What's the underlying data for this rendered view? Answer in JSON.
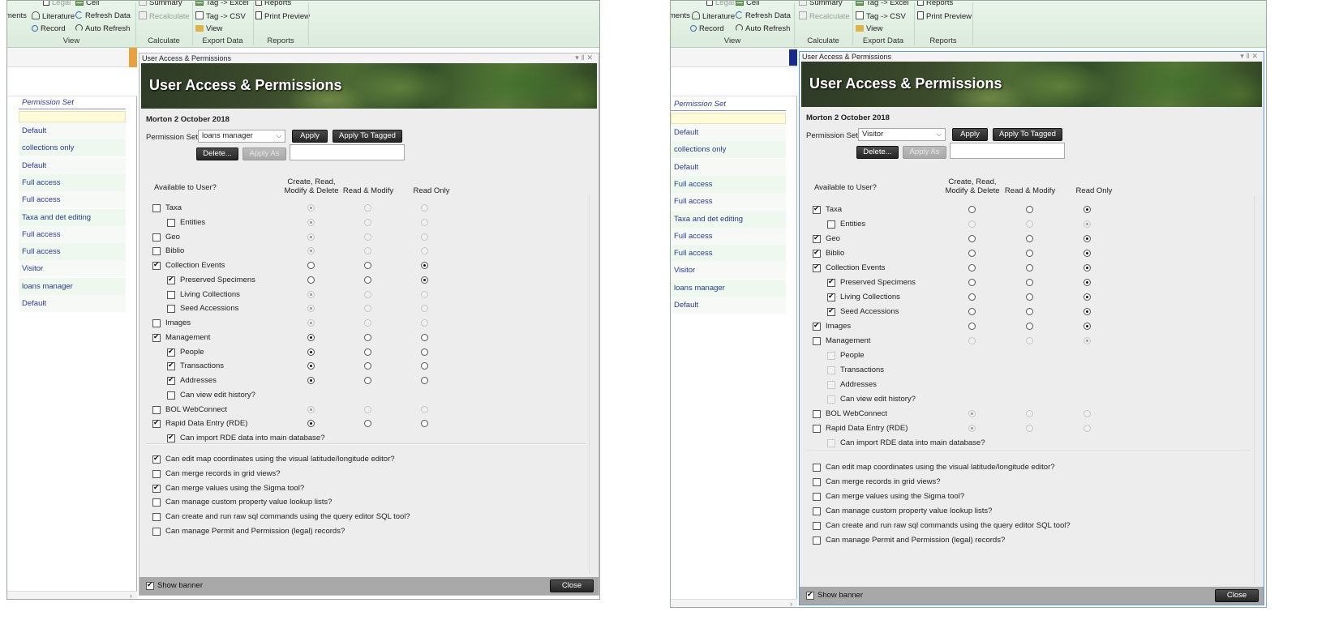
{
  "ribbon": {
    "items": {
      "legal": "Legal",
      "cell": "Cell",
      "summary": "Summary",
      "tag_excel": "Tag -> Excel",
      "reports_btn": "Reports",
      "ments": "ments",
      "literature": "Literature",
      "refresh_data": "Refresh Data",
      "recalculate": "Recalculate",
      "tag_csv": "Tag -> CSV",
      "print_preview": "Print Preview",
      "record": "Record",
      "auto_refresh": "Auto Refresh",
      "view_btn": "View"
    },
    "groups": {
      "view": "View",
      "calculate": "Calculate",
      "export": "Export Data",
      "reports": "Reports"
    }
  },
  "left": {
    "list_header": "Permission Set",
    "rows": [
      "Default",
      "collections only",
      "Default",
      "Full access",
      "Full access",
      "Taxa and det editing",
      "Full access",
      "Full access",
      "Visitor",
      "loans manager",
      "Default"
    ],
    "dialog": {
      "window_title": "User Access & Permissions",
      "banner_title": "User Access & Permissions",
      "subtitle": "Morton 2 October 2018",
      "perm_label": "Permission Set:",
      "perm_value": "loans manager",
      "apply": "Apply",
      "apply_tagged": "Apply To Tagged",
      "delete": "Delete...",
      "apply_as": "Apply As",
      "col_available": "Available to User?",
      "col_crmd_1": "Create, Read,",
      "col_crmd_2": "Modify & Delete",
      "col_rm": "Read & Modify",
      "col_ro": "Read Only",
      "modules": [
        {
          "label": "Taxa"
        },
        {
          "label": "Entities"
        },
        {
          "label": "Geo"
        },
        {
          "label": "Biblio"
        },
        {
          "label": "Collection Events"
        },
        {
          "label": "Preserved Specimens"
        },
        {
          "label": "Living Collections"
        },
        {
          "label": "Seed Accessions"
        },
        {
          "label": "Images"
        },
        {
          "label": "Management"
        },
        {
          "label": "People"
        },
        {
          "label": "Transactions"
        },
        {
          "label": "Addresses"
        },
        {
          "label": "Can view edit history?"
        },
        {
          "label": "BOL WebConnect"
        },
        {
          "label": "Rapid Data Entry (RDE)"
        },
        {
          "label": "Can import RDE data into main database?"
        }
      ],
      "options": [
        {
          "label": "Can edit map coordinates using the visual latitude/longitude editor?"
        },
        {
          "label": "Can merge records in grid views?"
        },
        {
          "label": "Can merge values using the Sigma tool?"
        },
        {
          "label": "Can manage custom property value lookup lists?"
        },
        {
          "label": "Can create and run raw sql commands using the query editor SQL tool?"
        },
        {
          "label": "Can manage Permit and Permission (legal) records?"
        }
      ],
      "show_banner": "Show banner",
      "close": "Close"
    }
  },
  "right": {
    "list_header": "Permission Set",
    "rows": [
      "Default",
      "collections only",
      "Default",
      "Full access",
      "Full access",
      "Taxa and det editing",
      "Full access",
      "Full access",
      "Visitor",
      "loans manager",
      "Default"
    ],
    "dialog": {
      "window_title": "User Access & Permissions",
      "banner_title": "User Access & Permissions",
      "subtitle": "Morton 2 October 2018",
      "perm_label": "Permission Set:",
      "perm_value": "Visitor",
      "apply": "Apply",
      "apply_tagged": "Apply To Tagged",
      "delete": "Delete...",
      "apply_as": "Apply As",
      "col_available": "Available to User?",
      "col_crmd_1": "Create, Read,",
      "col_crmd_2": "Modify & Delete",
      "col_rm": "Read & Modify",
      "col_ro": "Read Only",
      "modules": [
        {
          "label": "Taxa"
        },
        {
          "label": "Entities"
        },
        {
          "label": "Geo"
        },
        {
          "label": "Biblio"
        },
        {
          "label": "Collection Events"
        },
        {
          "label": "Preserved Specimens"
        },
        {
          "label": "Living Collections"
        },
        {
          "label": "Seed Accessions"
        },
        {
          "label": "Images"
        },
        {
          "label": "Management"
        },
        {
          "label": "People"
        },
        {
          "label": "Transactions"
        },
        {
          "label": "Addresses"
        },
        {
          "label": "Can view edit history?"
        },
        {
          "label": "BOL WebConnect"
        },
        {
          "label": "Rapid Data Entry (RDE)"
        },
        {
          "label": "Can import RDE data into main database?"
        }
      ],
      "options": [
        {
          "label": "Can edit map coordinates using the visual latitude/longitude editor?"
        },
        {
          "label": "Can merge records in grid views?"
        },
        {
          "label": "Can merge values using the Sigma tool?"
        },
        {
          "label": "Can manage custom property value lookup lists?"
        },
        {
          "label": "Can create and run raw sql commands using the query editor SQL tool?"
        },
        {
          "label": "Can manage Permit and Permission (legal) records?"
        }
      ],
      "show_banner": "Show banner",
      "close": "Close"
    }
  }
}
